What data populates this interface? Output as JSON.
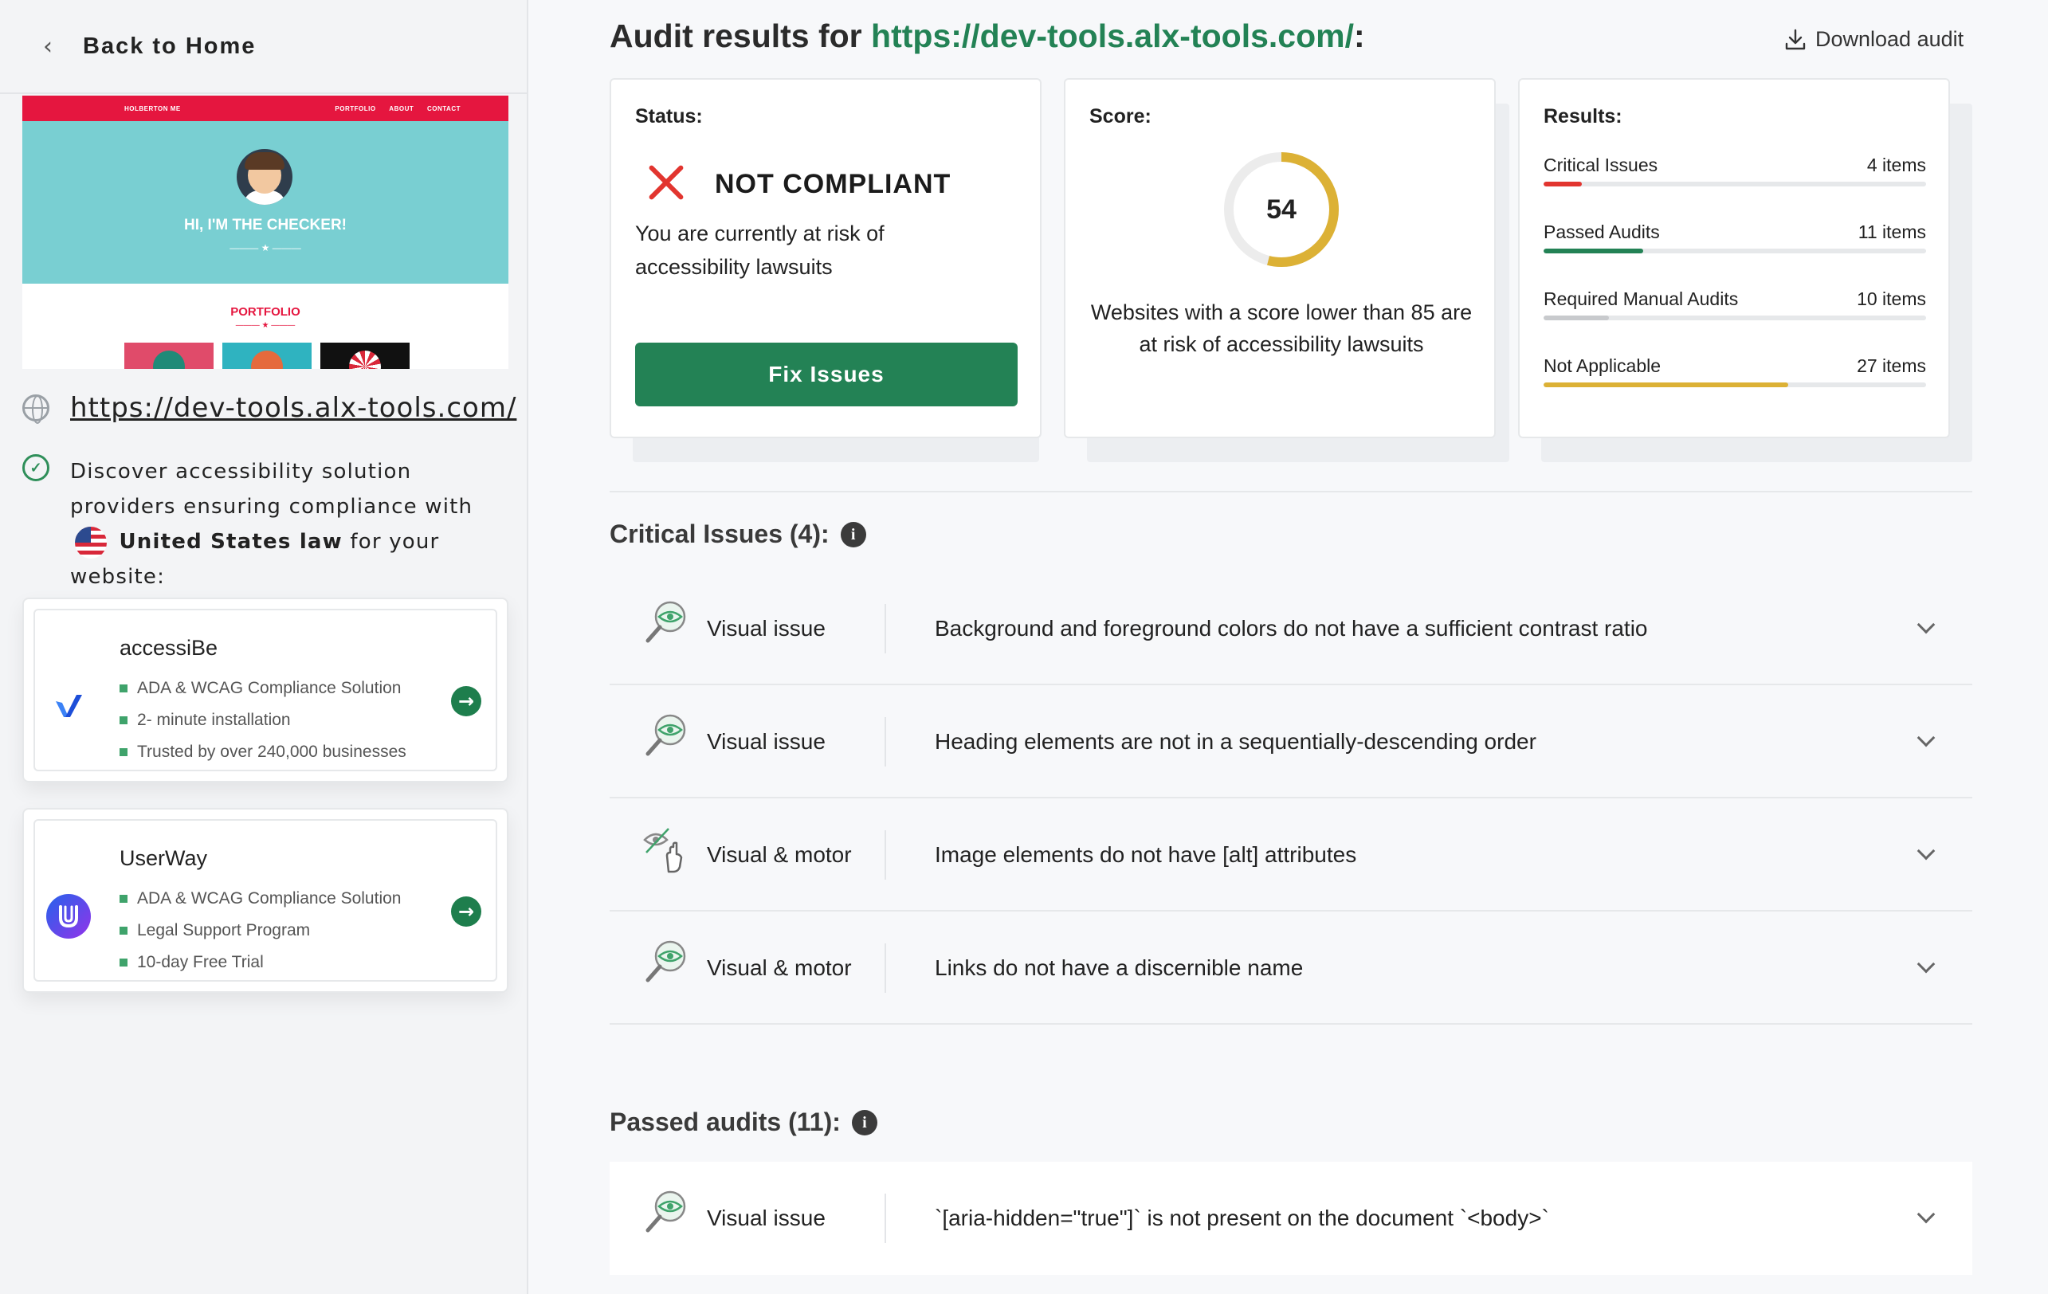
{
  "sidebar": {
    "back_label": "Back to Home",
    "preview": {
      "nav_brand": "HOLBERTON ME",
      "nav_links": [
        "PORTFOLIO",
        "ABOUT",
        "CONTACT"
      ],
      "hero_title": "HI, I'M THE CHECKER!",
      "section_title": "PORTFOLIO"
    },
    "site_url": "https://dev-tools.alx-tools.com/",
    "discover": {
      "text_before": "Discover accessibility solution providers ensuring compliance with",
      "country": "United States law",
      "text_after": "for your website:"
    },
    "vendors": [
      {
        "name": "accessiBe",
        "features": [
          "ADA & WCAG Compliance Solution",
          "2- minute installation",
          "Trusted by over 240,000 businesses"
        ]
      },
      {
        "name": "UserWay",
        "features": [
          "ADA & WCAG Compliance Solution",
          "Legal Support Program",
          "10-day Free Trial"
        ]
      }
    ]
  },
  "header": {
    "title_prefix": "Audit results for",
    "url": "https://dev-tools.alx-tools.com/",
    "title_suffix": ":",
    "download_label": "Download audit"
  },
  "status_card": {
    "heading": "Status:",
    "status": "NOT  COMPLIANT",
    "description": "You are currently at risk of accessibility lawsuits",
    "fix_label": "Fix Issues"
  },
  "score_card": {
    "heading": "Score:",
    "score": "54",
    "score_value": 54,
    "description": "Websites with a score lower than 85 are at risk of accessibility lawsuits"
  },
  "results_card": {
    "heading": "Results:",
    "rows": [
      {
        "label": "Critical Issues",
        "value": "4 items",
        "fraction": 0.1,
        "color": "#e2352f"
      },
      {
        "label": "Passed Audits",
        "value": "11 items",
        "fraction": 0.26,
        "color": "#238255"
      },
      {
        "label": "Required Manual Audits",
        "value": "10 items",
        "fraction": 0.17,
        "color": "#c8cacd"
      },
      {
        "label": "Not Applicable",
        "value": "27 items",
        "fraction": 0.64,
        "color": "#dcb135"
      }
    ]
  },
  "critical": {
    "title": "Critical Issues (4):",
    "items": [
      {
        "type": "Visual issue",
        "icon": "magnifier-eye-icon",
        "description": "Background and foreground colors do not have a sufficient contrast ratio"
      },
      {
        "type": "Visual issue",
        "icon": "magnifier-eye-icon",
        "description": "Heading elements are not in a sequentially-descending order"
      },
      {
        "type": "Visual & motor",
        "icon": "eye-hand-icon",
        "description": "Image elements do not have [alt] attributes"
      },
      {
        "type": "Visual & motor",
        "icon": "magnifier-eye-icon",
        "description": "Links do not have a discernible name"
      }
    ]
  },
  "passed": {
    "title": "Passed audits (11):",
    "items": [
      {
        "type": "Visual issue",
        "icon": "magnifier-eye-icon",
        "description": "`[aria-hidden=\"true\"]` is not present on the document `<body>`"
      }
    ]
  },
  "colors": {
    "brand_green": "#238255",
    "danger_red": "#e2352f",
    "score_gold": "#dcb135"
  }
}
